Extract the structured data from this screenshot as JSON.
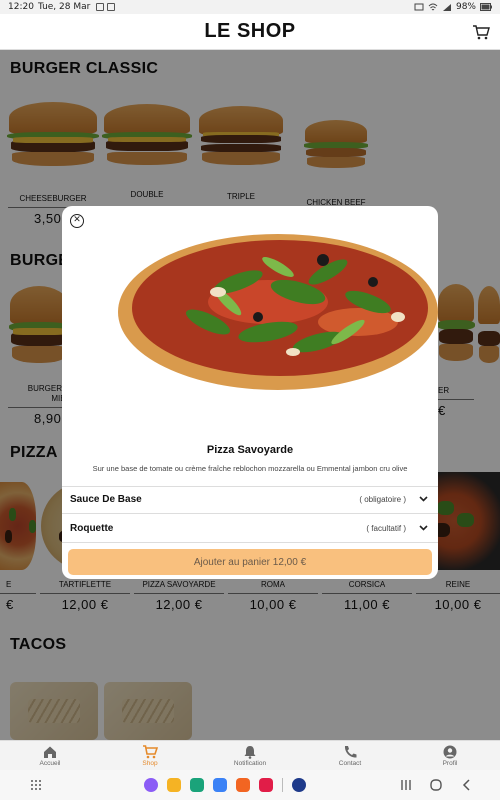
{
  "status": {
    "time": "12:20",
    "date": "Tue, 28 Mar",
    "battery": "98%"
  },
  "app": {
    "title": "LE SHOP"
  },
  "sections": {
    "burger_classic": {
      "title": "BURGER CLASSIC",
      "items": [
        {
          "name": "CHEESEBURGER",
          "price": "3,50"
        },
        {
          "name": "DOUBLE",
          "price": ""
        },
        {
          "name": "TRIPLE",
          "price": ""
        },
        {
          "name": "CHICKEN BEEF",
          "price": ""
        }
      ]
    },
    "burger2": {
      "title": "BURGE",
      "items": [
        {
          "name": "BURGER C",
          "name2": "MIEL",
          "price": "8,90"
        },
        {
          "name": "ER",
          "price": "€"
        }
      ]
    },
    "pizza": {
      "title": "PIZZA",
      "items": [
        {
          "name": "E",
          "price": "€"
        },
        {
          "name": "TARTIFLETTE",
          "price": "12,00 €"
        },
        {
          "name": "PIZZA SAVOYARDE",
          "price": "12,00 €"
        },
        {
          "name": "ROMA",
          "price": "10,00 €"
        },
        {
          "name": "CORSICA",
          "price": "11,00 €"
        },
        {
          "name": "REINE",
          "price": "10,00 €"
        }
      ]
    },
    "tacos": {
      "title": "TACOS"
    }
  },
  "modal": {
    "product_name": "Pizza Savoyarde",
    "description": "Sur une base de tomate ou crème fraîche reblochon mozzarella ou Emmental jambon cru olive",
    "options": [
      {
        "label": "Sauce De Base",
        "hint": "( obligatoire )"
      },
      {
        "label": "Roquette",
        "hint": "( facultatif )"
      }
    ],
    "add_button": "Ajouter au panier 12,00 €"
  },
  "nav": [
    {
      "label": "Accueil",
      "icon": "home-icon"
    },
    {
      "label": "Shop",
      "icon": "cart-icon",
      "active": true
    },
    {
      "label": "Notification",
      "icon": "bell-icon"
    },
    {
      "label": "Contact",
      "icon": "phone-icon"
    },
    {
      "label": "Profil",
      "icon": "person-icon"
    }
  ],
  "colors": {
    "accent": "#e58a2b",
    "button": "#f9c07e"
  }
}
